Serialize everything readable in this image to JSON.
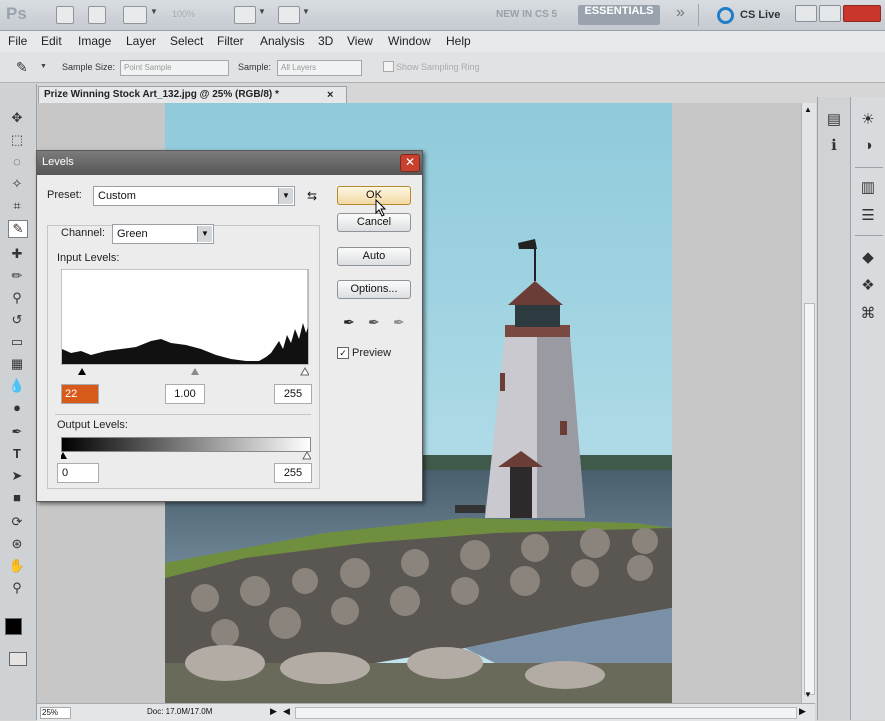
{
  "app": {
    "logo": "Ps",
    "zoom_dropdown": "100%",
    "workspace_new": "NEW IN CS 5",
    "workspace_active": "ESSENTIALS",
    "workspace_more": "»",
    "cs_live": "CS Live"
  },
  "menu": [
    "File",
    "Edit",
    "Image",
    "Layer",
    "Select",
    "Filter",
    "Analysis",
    "3D",
    "View",
    "Window",
    "Help"
  ],
  "options": {
    "sample_size_label": "Sample Size:",
    "sample_size_value": "Point Sample",
    "sample_label": "Sample:",
    "sample_value": "All Layers",
    "show_ring_label": "Show Sampling Ring"
  },
  "document": {
    "tab_title": "Prize Winning Stock Art_132.jpg @ 25% (RGB/8) *",
    "tab_close": "×",
    "zoom": "25%",
    "doc_size": "Doc: 17.0M/17.0M"
  },
  "levels": {
    "title": "Levels",
    "close": "✕",
    "preset_label": "Preset:",
    "preset_value": "Custom",
    "channel_label": "Channel:",
    "channel_value": "Green",
    "input_levels_label": "Input Levels:",
    "input_black": "22",
    "input_gamma": "1.00",
    "input_white": "255",
    "output_levels_label": "Output Levels:",
    "output_black": "0",
    "output_white": "255",
    "ok": "OK",
    "cancel": "Cancel",
    "auto": "Auto",
    "options": "Options...",
    "preview_label": "Preview",
    "preview_checked": true
  },
  "colors": {
    "sky": "#a9d5e2",
    "titlebar": "#5e5e5e",
    "close_red": "#c8412f"
  }
}
